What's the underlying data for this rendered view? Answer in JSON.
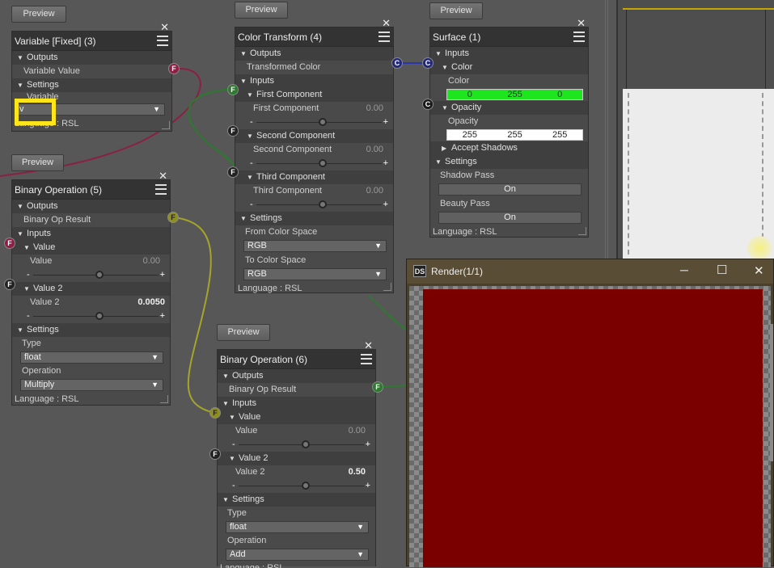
{
  "preview_label": "Preview",
  "common": {
    "outputs": "Outputs",
    "inputs": "Inputs",
    "settings": "Settings",
    "language": "Language : RSL",
    "close": "✕",
    "minus": "-",
    "plus": "+"
  },
  "var_node": {
    "title": "Variable [Fixed] (3)",
    "output": "Variable Value",
    "variable_label": "Variable",
    "variable_value": "v",
    "port_F": "F"
  },
  "binop5": {
    "title": "Binary Operation (5)",
    "output": "Binary Op Result",
    "value_sec": "Value",
    "value_label": "Value",
    "value_val": "0.00",
    "value2_sec": "Value 2",
    "value2_label": "Value 2",
    "value2_val": "0.0050",
    "type_label": "Type",
    "type_val": "float",
    "op_label": "Operation",
    "op_val": "Multiply",
    "port_F": "F"
  },
  "colortf": {
    "title": "Color Transform (4)",
    "output": "Transformed Color",
    "first_sec": "First Component",
    "first_label": "First Component",
    "first_val": "0.00",
    "second_sec": "Second Component",
    "second_label": "Second Component",
    "second_val": "0.00",
    "third_sec": "Third Component",
    "third_label": "Third Component",
    "third_val": "0.00",
    "from_label": "From Color Space",
    "from_val": "RGB",
    "to_label": "To Color Space",
    "to_val": "RGB",
    "port_C": "C",
    "port_F": "F"
  },
  "surface": {
    "title": "Surface (1)",
    "color_sec": "Color",
    "color_label": "Color",
    "color_vals": [
      "0",
      "255",
      "0"
    ],
    "opacity_sec": "Opacity",
    "opacity_label": "Opacity",
    "opacity_vals": [
      "255",
      "255",
      "255"
    ],
    "accept_shadows": "Accept Shadows",
    "shadow_pass": "Shadow Pass",
    "shadow_val": "On",
    "beauty_pass": "Beauty Pass",
    "beauty_val": "On",
    "color_green": "#1ee61e",
    "port_C": "C"
  },
  "binop6": {
    "title": "Binary Operation (6)",
    "output": "Binary Op Result",
    "value_sec": "Value",
    "value_label": "Value",
    "value_val": "0.00",
    "value2_sec": "Value 2",
    "value2_label": "Value 2",
    "value2_val": "0.50",
    "type_label": "Type",
    "type_val": "float",
    "op_label": "Operation",
    "op_val": "Add",
    "lang_partial": "Language : RSL",
    "port_F": "F"
  },
  "render": {
    "title": "Render(1/1)",
    "logo": "DS",
    "minimize": "─",
    "maximize": "☐",
    "close": "✕",
    "render_color": "#7a0000"
  }
}
